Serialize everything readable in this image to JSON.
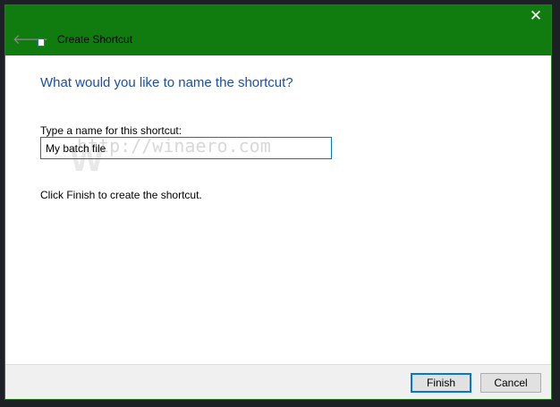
{
  "dialog": {
    "title": "Create Shortcut",
    "close_icon": "close-icon",
    "back_icon": "arrow-left-icon"
  },
  "main": {
    "question": "What would you like to name the shortcut?",
    "name_label": "Type a name for this shortcut:",
    "name_value": "My batch file",
    "info": "Click Finish to create the shortcut.",
    "watermark": "http://winaero.com"
  },
  "footer": {
    "finish": "Finish",
    "cancel": "Cancel"
  },
  "colors": {
    "header": "#107c10",
    "accent": "#0078d7",
    "question": "#1a4fa8"
  }
}
